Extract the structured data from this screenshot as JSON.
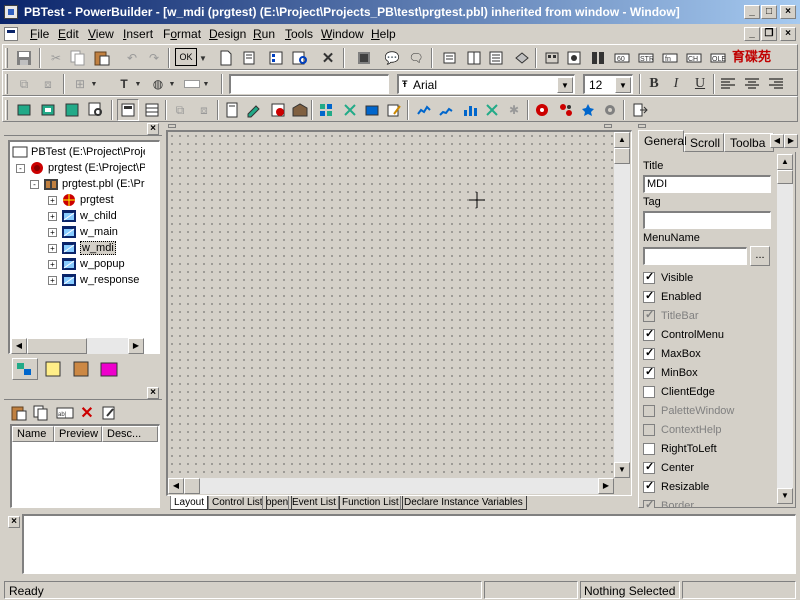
{
  "window": {
    "title": "PBTest - PowerBuilder - [w_mdi (prgtest) (E:\\Project\\Projects_PB\\test\\prgtest.pbl) inherited from window - Window]",
    "caption_buttons": {
      "minimize": "_",
      "maximize": "□",
      "close": "×"
    },
    "mdi_buttons": {
      "minimize": "_",
      "restore": "❐",
      "close": "×"
    },
    "watermark": "育碟苑"
  },
  "menu": [
    {
      "label": "File",
      "u": "F",
      "rest": "ile"
    },
    {
      "label": "Edit",
      "u": "E",
      "rest": "dit"
    },
    {
      "label": "View",
      "u": "V",
      "rest": "iew"
    },
    {
      "label": "Insert",
      "u": "I",
      "rest": "nsert"
    },
    {
      "label": "Format",
      "pre": "F",
      "u": "o",
      "rest": "rmat"
    },
    {
      "label": "Design",
      "u": "D",
      "rest": "esign"
    },
    {
      "label": "Run",
      "u": "R",
      "rest": "un"
    },
    {
      "label": "Tools",
      "u": "T",
      "rest": "ools"
    },
    {
      "label": "Window",
      "u": "W",
      "rest": "indow"
    },
    {
      "label": "Help",
      "u": "H",
      "rest": "elp"
    }
  ],
  "toolbar1": {
    "ok_label": "OK"
  },
  "toolbar2": {
    "font_name": "Arial",
    "font_size": "12",
    "bold": "B",
    "italic": "I",
    "underline": "U"
  },
  "library_tree": {
    "items": [
      {
        "label": "PBTest (E:\\Project\\Projec",
        "level": 0,
        "icon": "workspace-icon"
      },
      {
        "label": "prgtest (E:\\Project\\Pr",
        "level": 1,
        "icon": "target-icon",
        "expander": "-"
      },
      {
        "label": "prgtest.pbl (E:\\Pro",
        "level": 2,
        "icon": "library-icon",
        "expander": "-"
      },
      {
        "label": "prgtest",
        "level": 3,
        "icon": "application-icon",
        "expander": "+"
      },
      {
        "label": "w_child",
        "level": 3,
        "icon": "window-icon",
        "expander": "+"
      },
      {
        "label": "w_main",
        "level": 3,
        "icon": "window-icon",
        "expander": "+"
      },
      {
        "label": "w_mdi",
        "level": 3,
        "icon": "window-icon",
        "expander": "+",
        "selected": true
      },
      {
        "label": "w_popup",
        "level": 3,
        "icon": "window-icon",
        "expander": "+"
      },
      {
        "label": "w_response",
        "level": 3,
        "icon": "window-icon",
        "expander": "+"
      }
    ]
  },
  "clip_panel": {
    "columns": [
      "Name",
      "Preview",
      "Desc..."
    ]
  },
  "layout_tabs": [
    "Layout",
    "Control List",
    "open",
    "Event List",
    "Function List",
    "Declare Instance Variables"
  ],
  "properties": {
    "tabs": [
      "General",
      "Scroll",
      "Toolba"
    ],
    "title_label": "Title",
    "title_value": "MDI",
    "tag_label": "Tag",
    "tag_value": "",
    "menuname_label": "MenuName",
    "menuname_value": "",
    "browse_label": "...",
    "checks": [
      {
        "label": "Visible",
        "checked": true,
        "disabled": false
      },
      {
        "label": "Enabled",
        "checked": true,
        "disabled": false
      },
      {
        "label": "TitleBar",
        "checked": true,
        "disabled": true
      },
      {
        "label": "ControlMenu",
        "checked": true,
        "disabled": false
      },
      {
        "label": "MaxBox",
        "checked": true,
        "disabled": false
      },
      {
        "label": "MinBox",
        "checked": true,
        "disabled": false
      },
      {
        "label": "ClientEdge",
        "checked": false,
        "disabled": false
      },
      {
        "label": "PaletteWindow",
        "checked": false,
        "disabled": true
      },
      {
        "label": "ContextHelp",
        "checked": false,
        "disabled": true
      },
      {
        "label": "RightToLeft",
        "checked": false,
        "disabled": false
      },
      {
        "label": "Center",
        "checked": true,
        "disabled": false
      },
      {
        "label": "Resizable",
        "checked": true,
        "disabled": false
      },
      {
        "label": "Border",
        "checked": true,
        "disabled": true
      }
    ]
  },
  "status": {
    "left": "Ready",
    "right": "Nothing Selected"
  }
}
